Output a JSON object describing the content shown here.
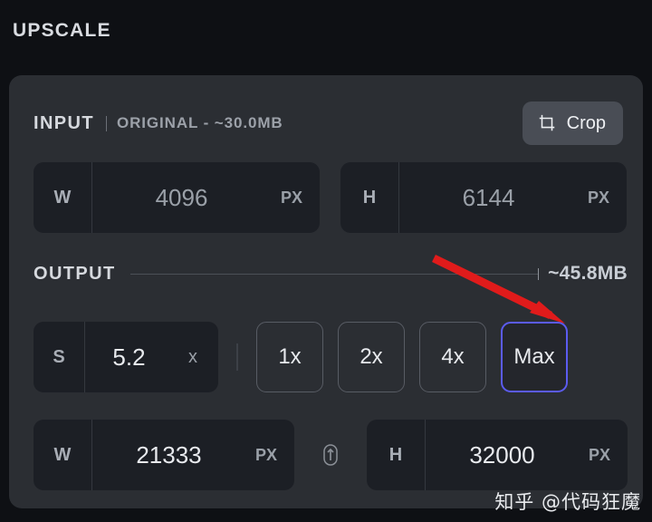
{
  "page": {
    "title": "UPSCALE",
    "accent_selected": "#5b5bf0",
    "panel_bg": "#2b2e33",
    "field_bg": "#1c1f25",
    "annotation_arrow_color": "#e01b1b"
  },
  "input_section": {
    "label": "INPUT",
    "meta": "ORIGINAL - ~30.0MB",
    "crop_button": {
      "label": "Crop",
      "icon": "crop-icon"
    },
    "fields": [
      {
        "key": "W",
        "value": "4096",
        "unit": "PX"
      },
      {
        "key": "H",
        "value": "6144",
        "unit": "PX"
      }
    ]
  },
  "output_section": {
    "label": "OUTPUT",
    "estimated_size": "~45.8MB",
    "scale_field": {
      "key": "S",
      "value": "5.2",
      "unit": "x"
    },
    "presets": [
      {
        "label": "1x",
        "selected": false
      },
      {
        "label": "2x",
        "selected": false
      },
      {
        "label": "4x",
        "selected": false
      },
      {
        "label": "Max",
        "selected": true
      }
    ],
    "link_button": {
      "icon": "link-chain-icon"
    },
    "fields": [
      {
        "key": "W",
        "value": "21333",
        "unit": "PX"
      },
      {
        "key": "H",
        "value": "32000",
        "unit": "PX"
      }
    ]
  },
  "watermark": {
    "text": "知乎 @代码狂魔"
  }
}
